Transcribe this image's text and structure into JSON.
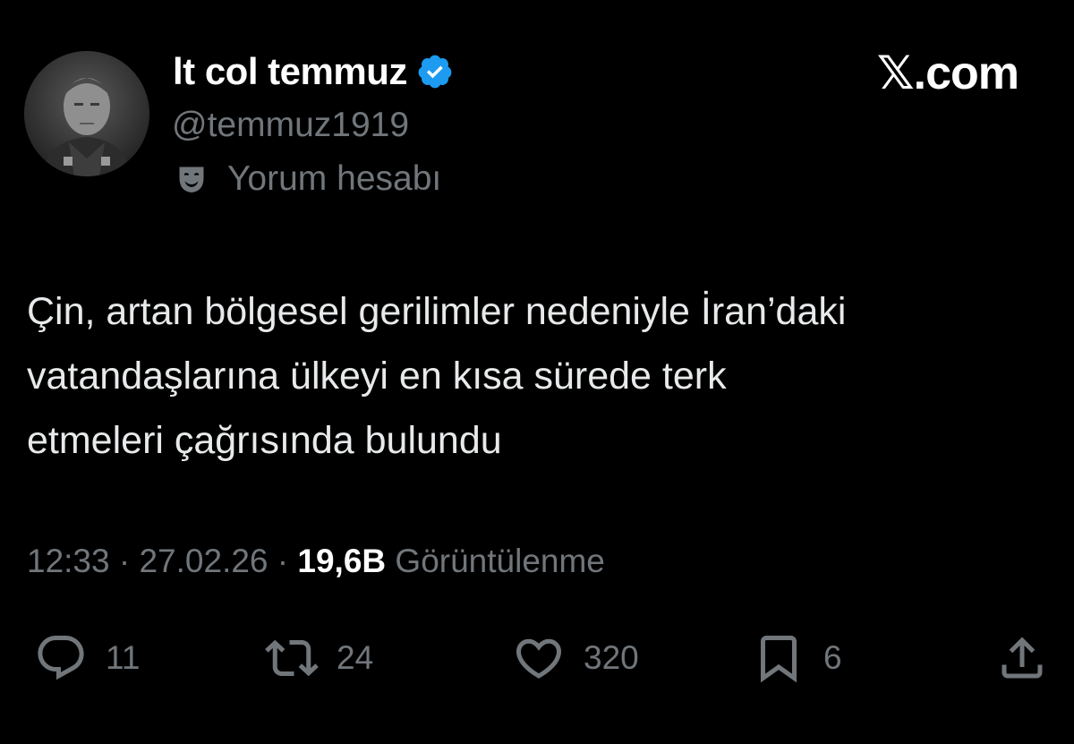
{
  "author": {
    "display_name": "lt col temmuz",
    "handle": "@temmuz1919",
    "label": "Yorum hesabı",
    "verified_color": "#1d9bf0"
  },
  "brand": "𝕏.com",
  "tweet": {
    "text": "Çin, artan bölgesel gerilimler nedeniyle İran’daki\nvatandaşlarına ülkeyi en kısa sürede terk\netmeleri çağrısında bulundu"
  },
  "meta": {
    "time": "12:33",
    "separator1": " · ",
    "date": "27.02.26",
    "separator2": " · ",
    "views": "19,6B",
    "views_label": "Görüntülenme"
  },
  "actions": {
    "reply": {
      "icon": "reply-icon",
      "count": "11"
    },
    "retweet": {
      "icon": "retweet-icon",
      "count": "24"
    },
    "like": {
      "icon": "heart-icon",
      "count": "320"
    },
    "bookmark": {
      "icon": "bookmark-icon",
      "count": "6"
    },
    "share": {
      "icon": "share-icon"
    }
  }
}
